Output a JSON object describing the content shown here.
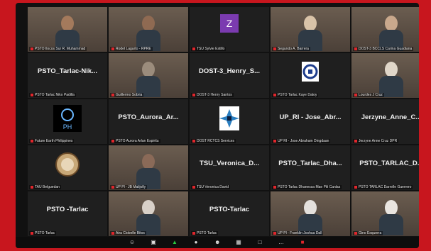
{
  "tiles": [
    {
      "type": "video",
      "label": "PSTO Ilocos Sur R. Muhammad",
      "face": "#a47a5c"
    },
    {
      "type": "video",
      "label": "Rodel Lagarto - RPRE",
      "face": "#8f6a52",
      "active": true
    },
    {
      "type": "avatar",
      "label": "TSU Sylvie Estillo",
      "avatar_letter": "Z"
    },
    {
      "type": "video",
      "label": "Segundo A. Barrera",
      "face": "#d9c3a8"
    },
    {
      "type": "video",
      "label": "DOST-3 BCCLS Carina Guadiana",
      "face": "#c9a88c"
    },
    {
      "type": "name",
      "name": "PSTO_Tarlac-Nik...",
      "label": "PSTO Tarlac Niko Padilla"
    },
    {
      "type": "video",
      "label": "Guillermo Sobria",
      "face": "#9b8c7c"
    },
    {
      "type": "name",
      "name": "DOST-3_Henry_S...",
      "label": "DOST-3 Henry Santos"
    },
    {
      "type": "logo",
      "label": "PSTO Tarlac Kaye Datoy",
      "logo": "dost-logo"
    },
    {
      "type": "video",
      "label": "Lourdes J Cruz",
      "face": "#e0d6c8"
    },
    {
      "type": "logo",
      "label": "Future Earth Philippines",
      "logo": "ph-logo"
    },
    {
      "type": "name",
      "name": "PSTO_Aurora_Ar...",
      "label": "PSTO Aurora Arlan Espiritu"
    },
    {
      "type": "logo",
      "label": "DOST RCTCS Services",
      "logo": "star-logo"
    },
    {
      "type": "name",
      "name": "UP_RI - Jose_Abr...",
      "label": "UP RI - Jose Abraham Dingdaan"
    },
    {
      "type": "name",
      "name": "Jerzyne_Anne_C...",
      "label": "Jerzyne Anne Cruz DPR"
    },
    {
      "type": "logo",
      "label": "TAU Belguedan",
      "logo": "seal-logo"
    },
    {
      "type": "video",
      "label": "UP Pl - JB Malijolly",
      "face": "#8a6a58"
    },
    {
      "type": "name",
      "name": "TSU_Veronica_D...",
      "label": "TSU Veronica David"
    },
    {
      "type": "name",
      "name": "PSTO_Tarlac_Dha...",
      "label": "PSTO Tarlac Dhanessa Mae Pili Canlas"
    },
    {
      "type": "name",
      "name": "PSTO_TARLAC_D...",
      "label": "PSTO TARLAC Darrelle Guerrero"
    },
    {
      "type": "name",
      "name": "PSTO -Tarlac",
      "label": "PSTO Tarlac"
    },
    {
      "type": "video",
      "label": "Aira Ciobelle Bitos",
      "face": "#d8d0c8"
    },
    {
      "type": "name",
      "name": "PSTO-Tarlac",
      "label": "PSTO Tarlac"
    },
    {
      "type": "video",
      "label": "UP Pl - Franklin Joshua Dall",
      "face": "#e4e0dc"
    },
    {
      "type": "video",
      "label": "Gino Esquerra",
      "face": "#e9e5e0"
    }
  ],
  "toolbar_icons": [
    "participants-icon",
    "chat-icon",
    "share-screen-icon",
    "record-icon",
    "reactions-icon",
    "apps-icon",
    "whiteboard-icon",
    "more-icon",
    "end-icon"
  ]
}
